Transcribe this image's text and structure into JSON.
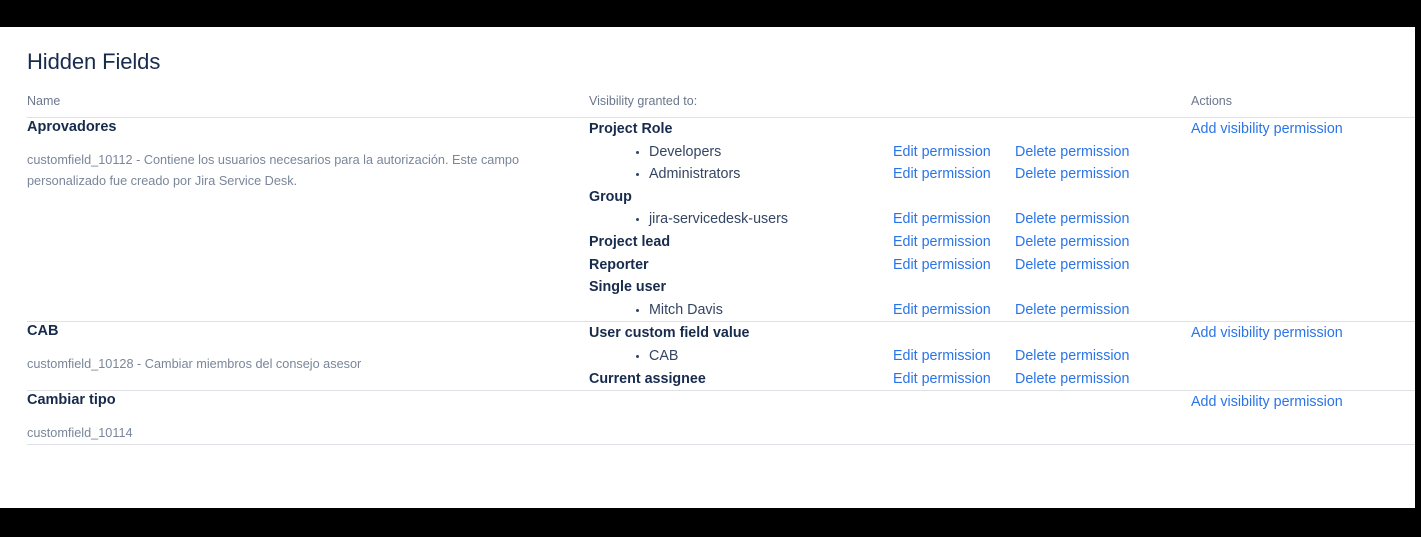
{
  "page": {
    "title": "Hidden Fields"
  },
  "table": {
    "headers": {
      "name": "Name",
      "visibility": "Visibility granted to:",
      "edit": "",
      "delete": "",
      "actions": "Actions"
    },
    "labels": {
      "edit_permission": "Edit permission",
      "delete_permission": "Delete permission",
      "add_visibility_permission": "Add visibility permission"
    },
    "rows": [
      {
        "name": "Aprovadores",
        "description": "customfield_10112 - Contiene los usuarios necesarios para la autorización. Este campo personalizado fue creado por Jira Service Desk.",
        "add_action": "Add visibility permission",
        "permissions": [
          {
            "type": "group-label",
            "label": "Project Role",
            "has_links": false
          },
          {
            "type": "item",
            "label": "Developers",
            "has_links": true
          },
          {
            "type": "item",
            "label": "Administrators",
            "has_links": true
          },
          {
            "type": "group-label",
            "label": "Group",
            "has_links": false
          },
          {
            "type": "item",
            "label": "jira-servicedesk-users",
            "has_links": true
          },
          {
            "type": "group-label",
            "label": "Project lead",
            "has_links": true
          },
          {
            "type": "group-label",
            "label": "Reporter",
            "has_links": true
          },
          {
            "type": "group-label",
            "label": "Single user",
            "has_links": false
          },
          {
            "type": "item",
            "label": "Mitch Davis",
            "has_links": true
          }
        ]
      },
      {
        "name": "CAB",
        "description": "customfield_10128 - Cambiar miembros del consejo asesor",
        "add_action": "Add visibility permission",
        "permissions": [
          {
            "type": "group-label",
            "label": "User custom field value",
            "has_links": false
          },
          {
            "type": "item",
            "label": "CAB",
            "has_links": true
          },
          {
            "type": "group-label",
            "label": "Current assignee",
            "has_links": true
          }
        ]
      },
      {
        "name": "Cambiar tipo",
        "description": "customfield_10114",
        "add_action": "Add visibility permission",
        "permissions": []
      }
    ]
  },
  "colors": {
    "link": "#2A74E8",
    "heading": "#172B4D",
    "muted": "#6B778C",
    "description": "#7A869A",
    "divider": "#DFE1E6",
    "background": "#FFFFFF",
    "letterbox": "#000000"
  }
}
